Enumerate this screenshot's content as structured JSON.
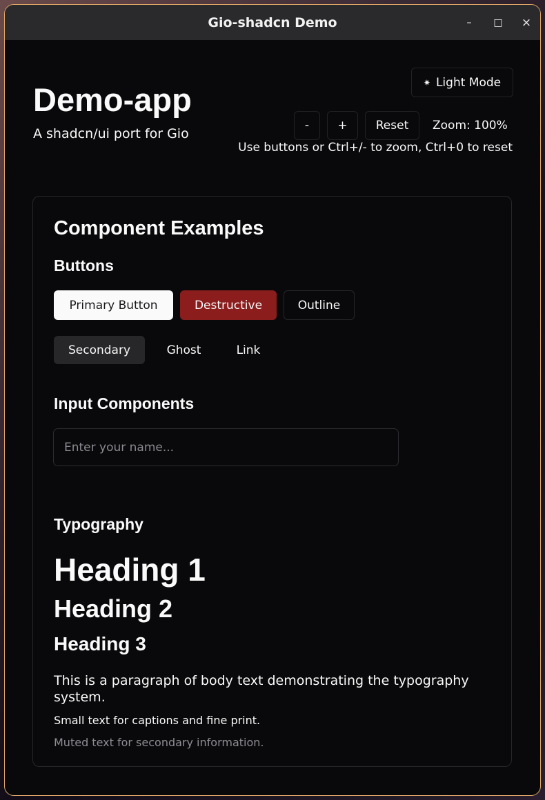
{
  "window": {
    "title": "Gio-shadcn Demo",
    "minimize": "–",
    "maximize": "□",
    "close": "×"
  },
  "header": {
    "title": "Demo-app",
    "subtitle": "A shadcn/ui port for Gio",
    "theme_icon": "✷",
    "theme_label": "Light Mode",
    "zoom_out": "-",
    "zoom_in": "+",
    "reset": "Reset",
    "zoom_label": "Zoom: 100%",
    "hint": "Use buttons or Ctrl+/- to zoom, Ctrl+0 to reset"
  },
  "card": {
    "title": "Component Examples",
    "buttons": {
      "heading": "Buttons",
      "primary": "Primary Button",
      "destructive": "Destructive",
      "outline": "Outline",
      "secondary": "Secondary",
      "ghost": "Ghost",
      "link": "Link"
    },
    "inputs": {
      "heading": "Input Components",
      "placeholder": "Enter your name..."
    },
    "typography": {
      "heading": "Typography",
      "h1": "Heading 1",
      "h2": "Heading 2",
      "h3": "Heading 3",
      "body": "This is a paragraph of body text demonstrating the typography system.",
      "small": "Small text for captions and fine print.",
      "muted": "Muted text for secondary information."
    }
  },
  "colors": {
    "destructive": "#8b1d1d",
    "secondary": "#27272a",
    "primary": "#fafafa"
  }
}
